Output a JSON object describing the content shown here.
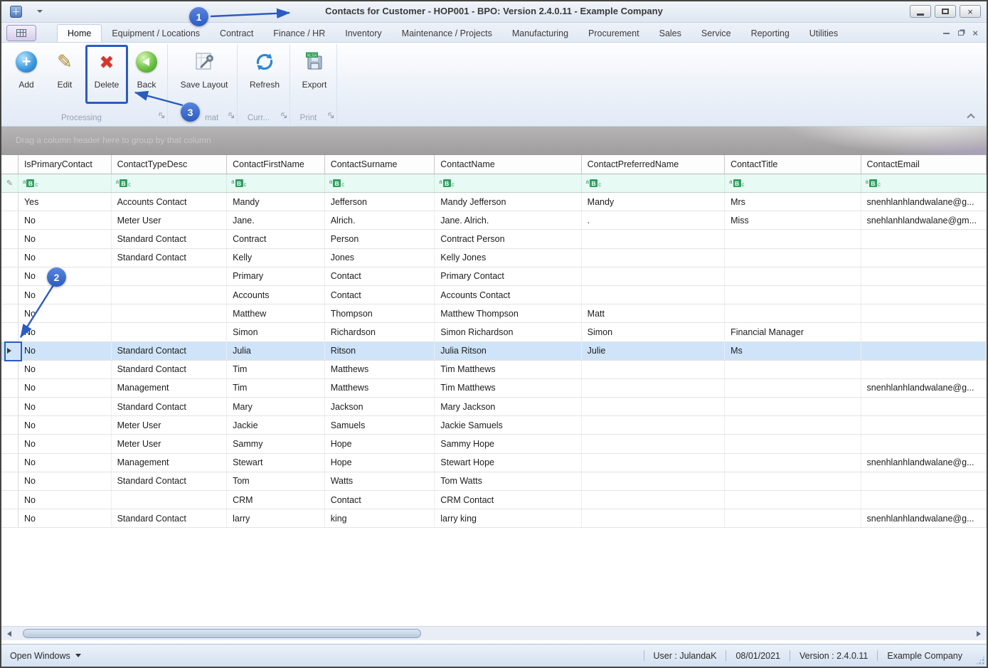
{
  "colors": {
    "annotation_blue": "#2b5cc0",
    "selected_row": "#cfe4f9",
    "filter_row_bg": "#e7faf3",
    "abc_green": "#2da05f",
    "delete_red": "#d6372c",
    "add_blue": "#2f86cf",
    "back_green": "#58b43c"
  },
  "titlebar": {
    "title": "Contacts for Customer - HOP001 - BPO: Version 2.4.0.11 - Example Company"
  },
  "ribbon": {
    "tabs": [
      {
        "label": "Home",
        "active": true
      },
      {
        "label": "Equipment / Locations",
        "active": false
      },
      {
        "label": "Contract",
        "active": false
      },
      {
        "label": "Finance / HR",
        "active": false
      },
      {
        "label": "Inventory",
        "active": false
      },
      {
        "label": "Maintenance / Projects",
        "active": false
      },
      {
        "label": "Manufacturing",
        "active": false
      },
      {
        "label": "Procurement",
        "active": false
      },
      {
        "label": "Sales",
        "active": false
      },
      {
        "label": "Service",
        "active": false
      },
      {
        "label": "Reporting",
        "active": false
      },
      {
        "label": "Utilities",
        "active": false
      }
    ],
    "buttons": {
      "add": "Add",
      "edit": "Edit",
      "delete": "Delete",
      "back": "Back",
      "save_layout": "Save Layout",
      "refresh": "Refresh",
      "export": "Export"
    },
    "export_badge": "XLSX",
    "groups": {
      "processing": "Processing",
      "format": "mat",
      "current": "Curr...",
      "print": "Print"
    }
  },
  "grid": {
    "group_hint": "Drag a column header here to group by that column",
    "columns": [
      "IsPrimaryContact",
      "ContactTypeDesc",
      "ContactFirstName",
      "ContactSurname",
      "ContactName",
      "ContactPreferredName",
      "ContactTitle",
      "ContactEmail"
    ],
    "rows": [
      {
        "selected": false,
        "cells": [
          "Yes",
          "Accounts Contact",
          "Mandy",
          "Jefferson",
          "Mandy Jefferson",
          "Mandy",
          "Mrs",
          "snenhlanhlandwalane@g..."
        ]
      },
      {
        "selected": false,
        "cells": [
          "No",
          "Meter User",
          "Jane.",
          "Alrich.",
          "Jane. Alrich.",
          ".",
          "Miss",
          "snehlanhlandwalane@gm..."
        ]
      },
      {
        "selected": false,
        "cells": [
          "No",
          "Standard Contact",
          "Contract",
          "Person",
          "Contract Person",
          "",
          "",
          ""
        ]
      },
      {
        "selected": false,
        "cells": [
          "No",
          "Standard Contact",
          "Kelly",
          "Jones",
          "Kelly Jones",
          "",
          "",
          ""
        ]
      },
      {
        "selected": false,
        "cells": [
          "No",
          "",
          "Primary",
          "Contact",
          "Primary Contact",
          "",
          "",
          ""
        ]
      },
      {
        "selected": false,
        "cells": [
          "No",
          "",
          "Accounts",
          "Contact",
          "Accounts Contact",
          "",
          "",
          ""
        ]
      },
      {
        "selected": false,
        "cells": [
          "No",
          "",
          "Matthew",
          "Thompson",
          "Matthew Thompson",
          "Matt",
          "",
          ""
        ]
      },
      {
        "selected": false,
        "cells": [
          "No",
          "",
          "Simon",
          "Richardson",
          "Simon Richardson",
          "Simon",
          "Financial Manager",
          ""
        ]
      },
      {
        "selected": true,
        "cells": [
          "No",
          "Standard Contact",
          "Julia",
          "Ritson",
          "Julia Ritson",
          "Julie",
          "Ms",
          ""
        ]
      },
      {
        "selected": false,
        "cells": [
          "No",
          "Standard Contact",
          "Tim",
          "Matthews",
          "Tim Matthews",
          "",
          "",
          ""
        ]
      },
      {
        "selected": false,
        "cells": [
          "No",
          "Management",
          "Tim",
          "Matthews",
          "Tim Matthews",
          "",
          "",
          "snenhlanhlandwalane@g..."
        ]
      },
      {
        "selected": false,
        "cells": [
          "No",
          "Standard Contact",
          "Mary",
          "Jackson",
          "Mary Jackson",
          "",
          "",
          ""
        ]
      },
      {
        "selected": false,
        "cells": [
          "No",
          "Meter User",
          "Jackie",
          "Samuels",
          "Jackie Samuels",
          "",
          "",
          ""
        ]
      },
      {
        "selected": false,
        "cells": [
          "No",
          "Meter User",
          "Sammy",
          "Hope",
          "Sammy Hope",
          "",
          "",
          ""
        ]
      },
      {
        "selected": false,
        "cells": [
          "No",
          "Management",
          "Stewart",
          "Hope",
          "Stewart Hope",
          "",
          "",
          "snenhlanhlandwalane@g..."
        ]
      },
      {
        "selected": false,
        "cells": [
          "No",
          "Standard Contact",
          "Tom",
          "Watts",
          "Tom Watts",
          "",
          "",
          ""
        ]
      },
      {
        "selected": false,
        "cells": [
          "No",
          "",
          "CRM",
          "Contact",
          "CRM Contact",
          "",
          "",
          ""
        ]
      },
      {
        "selected": false,
        "cells": [
          "No",
          "Standard Contact",
          "larry",
          "king",
          "larry king",
          "",
          "",
          "snenhlanhlandwalane@g..."
        ]
      }
    ]
  },
  "statusbar": {
    "open_windows": "Open Windows",
    "items": [
      "User : JulandaK",
      "08/01/2021",
      "Version : 2.4.0.11",
      "Example Company"
    ]
  },
  "annotations": [
    "1",
    "2",
    "3"
  ]
}
